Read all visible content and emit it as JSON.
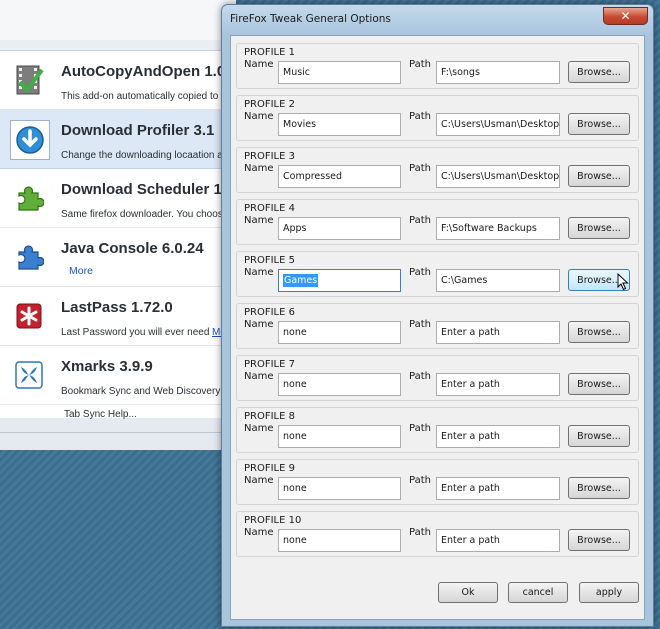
{
  "dialog": {
    "title": "FireFox Tweak General Options",
    "close_glyph": "✕",
    "labels": {
      "name": "Name",
      "path": "Path"
    },
    "browse_label": "Browse...",
    "profiles": [
      {
        "title": "PROFILE 1",
        "name": "Music",
        "path": "F:\\songs"
      },
      {
        "title": "PROFILE 2",
        "name": "Movies",
        "path": "C:\\Users\\Usman\\Desktop\\M"
      },
      {
        "title": "PROFILE 3",
        "name": "Compressed",
        "path": "C:\\Users\\Usman\\Desktop\\C"
      },
      {
        "title": "PROFILE 4",
        "name": "Apps",
        "path": "F:\\Software Backups"
      },
      {
        "title": "PROFILE 5",
        "name": "Games",
        "path": "C:\\Games"
      },
      {
        "title": "PROFILE 6",
        "name": "none",
        "path": "Enter a path"
      },
      {
        "title": "PROFILE 7",
        "name": "none",
        "path": "Enter a path"
      },
      {
        "title": "PROFILE 8",
        "name": "none",
        "path": "Enter a path"
      },
      {
        "title": "PROFILE 9",
        "name": "none",
        "path": "Enter a path"
      },
      {
        "title": "PROFILE 10",
        "name": "none",
        "path": "Enter a path"
      }
    ],
    "buttons": {
      "ok": "Ok",
      "cancel": "cancel",
      "apply": "apply"
    }
  },
  "addons": {
    "items": [
      {
        "name": "AutoCopyAndOpen 1.0",
        "desc": "This add-on automatically copied to",
        "icon": "film-check-icon"
      },
      {
        "name": "Download Profiler 3.1",
        "desc": "Change the downloading locaation a",
        "icon": "download-arrow-icon"
      },
      {
        "name": "Download Scheduler 1",
        "desc": "Same firefox downloader. You choos",
        "icon": "puzzle-piece-icon"
      },
      {
        "name": "Java Console 6.0.24",
        "more": "More",
        "icon": "puzzle-piece-blue-icon"
      },
      {
        "name": "LastPass 1.72.0",
        "desc": "Last Password you will ever need",
        "link": "Mo",
        "icon": "lastpass-star-icon"
      },
      {
        "name": "Xmarks 3.9.9",
        "desc": "Bookmark Sync and Web Discovery",
        "icon": "xmarks-butterfly-icon"
      }
    ],
    "cutoff_text": "Tab Sync Help..."
  },
  "colors": {
    "selection": "#3399ff",
    "link": "#1c56c9",
    "close_button": "#c74a32",
    "frame": "#a9c5de"
  }
}
